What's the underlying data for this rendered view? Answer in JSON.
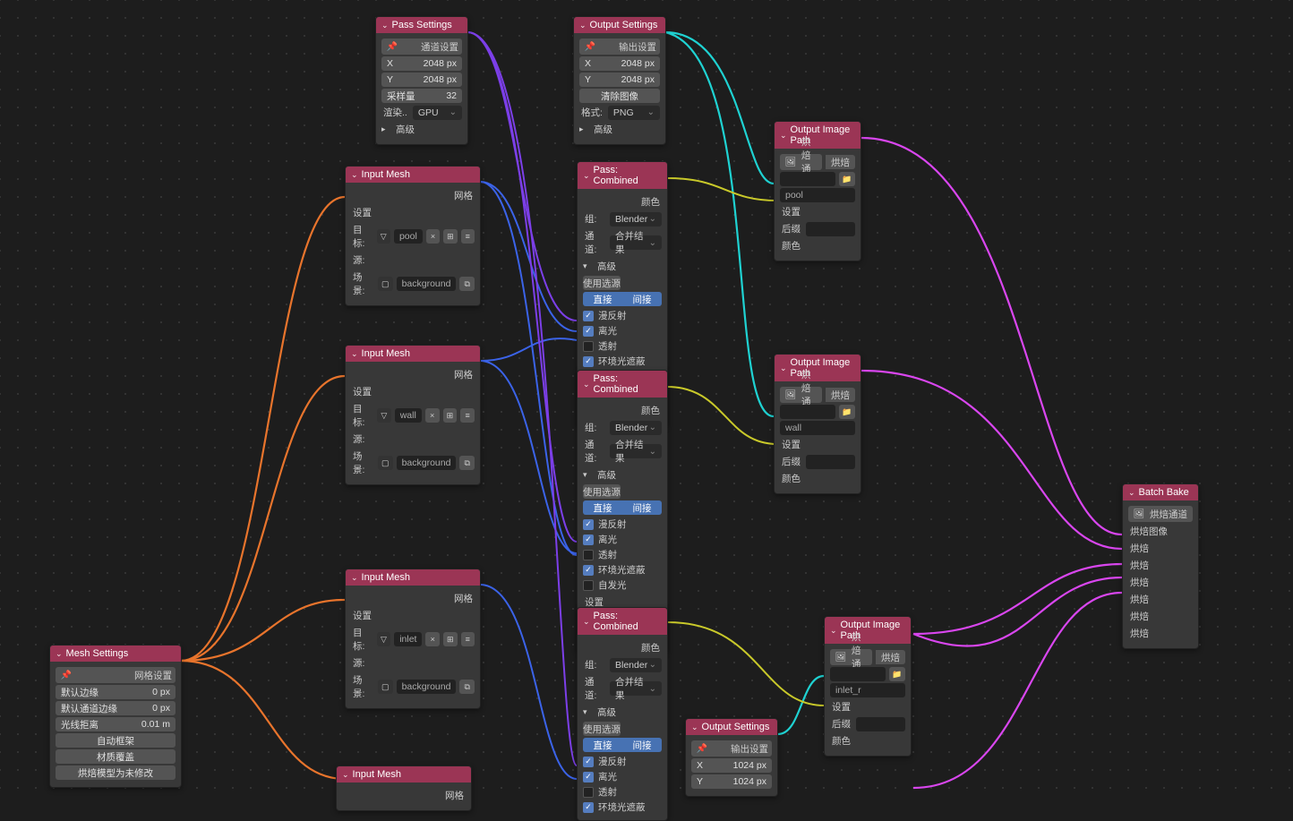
{
  "nodes": {
    "meshSettings": {
      "title": "Mesh Settings",
      "label_row": "网格设置",
      "default_margin_label": "默认边缘",
      "default_margin_val": "0 px",
      "default_channel_margin_label": "默认通道边缘",
      "default_channel_margin_val": "0 px",
      "ray_distance_label": "光线拒离",
      "ray_distance_val": "0.01 m",
      "auto_cage": "自动框架",
      "material_override": "材质覆盖",
      "bake_no_modify": "烘焙模型为未修改"
    },
    "passSettings": {
      "title": "Pass Settings",
      "label_row": "通道设置",
      "x_label": "X",
      "x_val": "2048 px",
      "y_label": "Y",
      "y_val": "2048 px",
      "samples_label": "采样量",
      "samples_val": "32",
      "render_label": "渲染..",
      "render_val": "GPU",
      "advanced": "高级"
    },
    "outputSettings": {
      "title": "Output Settings",
      "label_row": "输出设置",
      "x_label": "X",
      "x_val": "2048 px",
      "y_label": "Y",
      "y_val": "2048 px",
      "clear_image": "清除图像",
      "format_label": "格式:",
      "format_val": "PNG",
      "advanced": "高级"
    },
    "outputSettings2": {
      "title": "Output Settings",
      "label_row": "输出设置",
      "x_label": "X",
      "x_val": "1024 px",
      "y_label": "Y",
      "y_val": "1024 px"
    },
    "inputMesh": {
      "title": "Input Mesh",
      "mesh_out": "网格",
      "settings_in": "设置",
      "target_label": "目标:",
      "source_label": "源:",
      "scene_label": "场景:",
      "scene_val": "background"
    },
    "inputMesh1_target": "pool",
    "inputMesh2_target": "wall",
    "inputMesh3_target": "inlet",
    "passCombined": {
      "title": "Pass: Combined",
      "color_out": "颜色",
      "group_label": "组:",
      "group_val": "Blender",
      "channel_label": "通道:",
      "channel_val": "合并结果",
      "advanced": "高级",
      "use_source": "使用选源",
      "direct": "直接",
      "indirect": "间接",
      "diffuse": "漫反射",
      "glossy": "离光",
      "transmission": "透射",
      "ao": "环境光遮蔽",
      "emit": "自发光",
      "settings_in": "设置",
      "mesh_in": "网格"
    },
    "outputImagePath": {
      "title": "Output Image Path",
      "bake_channel": "烘焙通道",
      "bake": "烘焙",
      "settings_in": "设置",
      "suffix_in": "后缀",
      "color_in": "颜色"
    },
    "outputImagePath1_name": "pool",
    "outputImagePath2_name": "wall",
    "outputImagePath3_name": "inlet_r",
    "batchBake": {
      "title": "Batch Bake",
      "bake_channel": "烘焙通道",
      "bake_image": "烘焙图像",
      "bake": "烘焙"
    }
  }
}
